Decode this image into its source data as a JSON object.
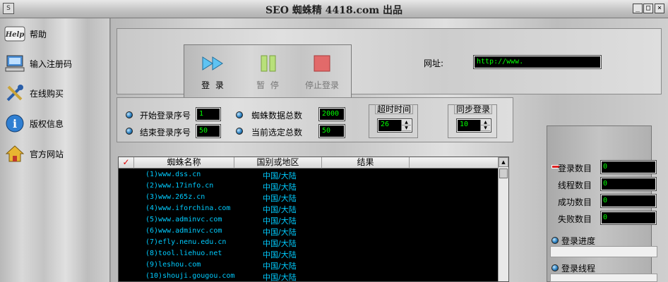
{
  "window": {
    "title": "SEO 蜘蛛精 4418.com 出品",
    "icon_text": "S",
    "minimize": "_",
    "maximize": "□",
    "close": "×"
  },
  "sidebar": {
    "items": [
      {
        "label": "帮助",
        "icon": "help-icon",
        "glyph": "Help"
      },
      {
        "label": "输入注册码",
        "icon": "computer-icon",
        "glyph": "🖥"
      },
      {
        "label": "在线购买",
        "icon": "tools-icon",
        "glyph": "🔧"
      },
      {
        "label": "版权信息",
        "icon": "info-icon",
        "glyph": "i"
      },
      {
        "label": "官方网站",
        "icon": "home-icon",
        "glyph": "🏠"
      }
    ]
  },
  "toolbar": {
    "login_label": "登 录",
    "pause_label": "暂 停",
    "stop_label": "停止登录",
    "url_label": "网址:",
    "url_value": "http://www."
  },
  "settings": {
    "start_label": "开始登录序号",
    "start_value": "1",
    "end_label": "结束登录序号",
    "end_value": "50",
    "total_label": "蜘蛛数据总数",
    "total_value": "2000",
    "selected_label": "当前选定总数",
    "selected_value": "50",
    "timeout_title": "超时时间",
    "timeout_value": "26",
    "sync_title": "同步登录",
    "sync_value": "10",
    "spin_up": "▲",
    "spin_down": "▼"
  },
  "list": {
    "check_mark": "✓",
    "columns": [
      "蜘蛛名称",
      "国别或地区",
      "结果"
    ],
    "rows": [
      {
        "name": "(1)www.dss.cn",
        "region": "中国/大陆"
      },
      {
        "name": "(2)www.17info.cn",
        "region": "中国/大陆"
      },
      {
        "name": "(3)www.265z.cn",
        "region": "中国/大陆"
      },
      {
        "name": "(4)www.iforchina.com",
        "region": "中国/大陆"
      },
      {
        "name": "(5)www.adminvc.com",
        "region": "中国/大陆"
      },
      {
        "name": "(6)www.adminvc.com",
        "region": "中国/大陆"
      },
      {
        "name": "(7)efly.nenu.edu.cn",
        "region": "中国/大陆"
      },
      {
        "name": "(8)tool.liehuo.net",
        "region": "中国/大陆"
      },
      {
        "name": "(9)leshou.com",
        "region": "中国/大陆"
      },
      {
        "name": "(10)shouji.gougou.com",
        "region": "中国/大陆"
      }
    ],
    "scroll_up": "▲"
  },
  "stats": {
    "login_count_label": "登录数目",
    "login_count_value": "0",
    "threads_label": "线程数目",
    "threads_value": "0",
    "success_label": "成功数目",
    "success_value": "0",
    "fail_label": "失败数目",
    "fail_value": "0",
    "progress_label": "登录进度",
    "thread_label": "登录线程"
  }
}
